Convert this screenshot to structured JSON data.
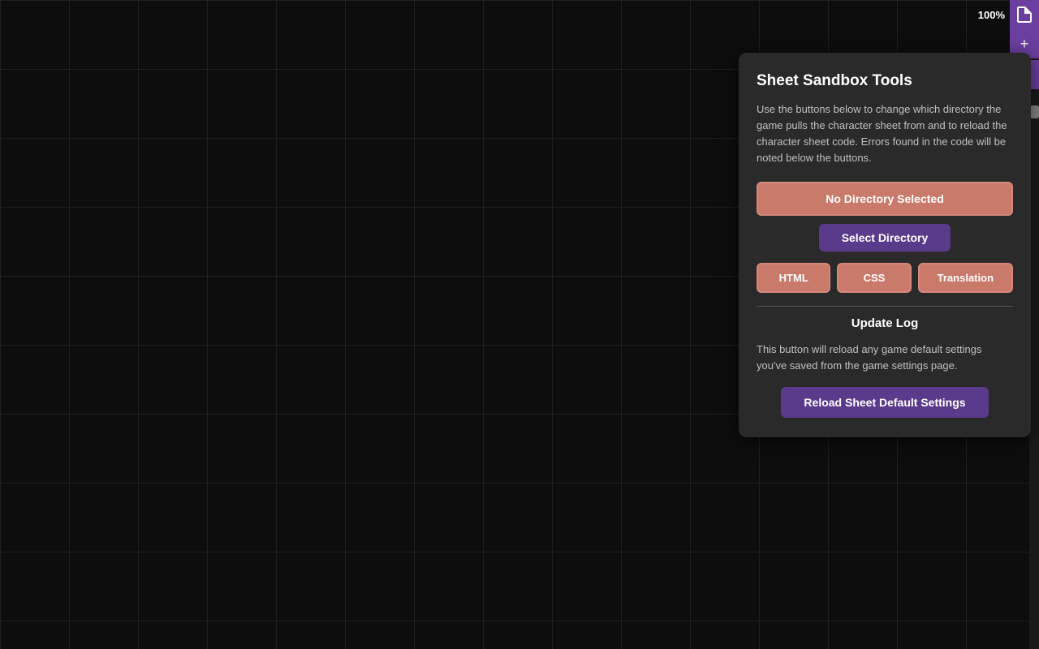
{
  "background": {
    "grid_color": "#0d0d0d"
  },
  "toolbar": {
    "zoom_label": "100%",
    "file_icon": "📄",
    "plus_icon": "+",
    "minus_icon": "−"
  },
  "panel": {
    "title": "Sheet Sandbox Tools",
    "description": "Use the buttons below to change which directory the game pulls the character sheet from and to reload the character sheet code. Errors found in the code will be noted below the buttons.",
    "no_directory_label": "No Directory Selected",
    "select_directory_label": "Select Directory",
    "file_type_buttons": [
      {
        "label": "HTML"
      },
      {
        "label": "CSS"
      },
      {
        "label": "Translation"
      }
    ],
    "update_log_title": "Update Log",
    "reload_description": "This button will reload any game default settings you've saved from the game settings page.",
    "reload_button_label": "Reload Sheet Default Settings"
  }
}
